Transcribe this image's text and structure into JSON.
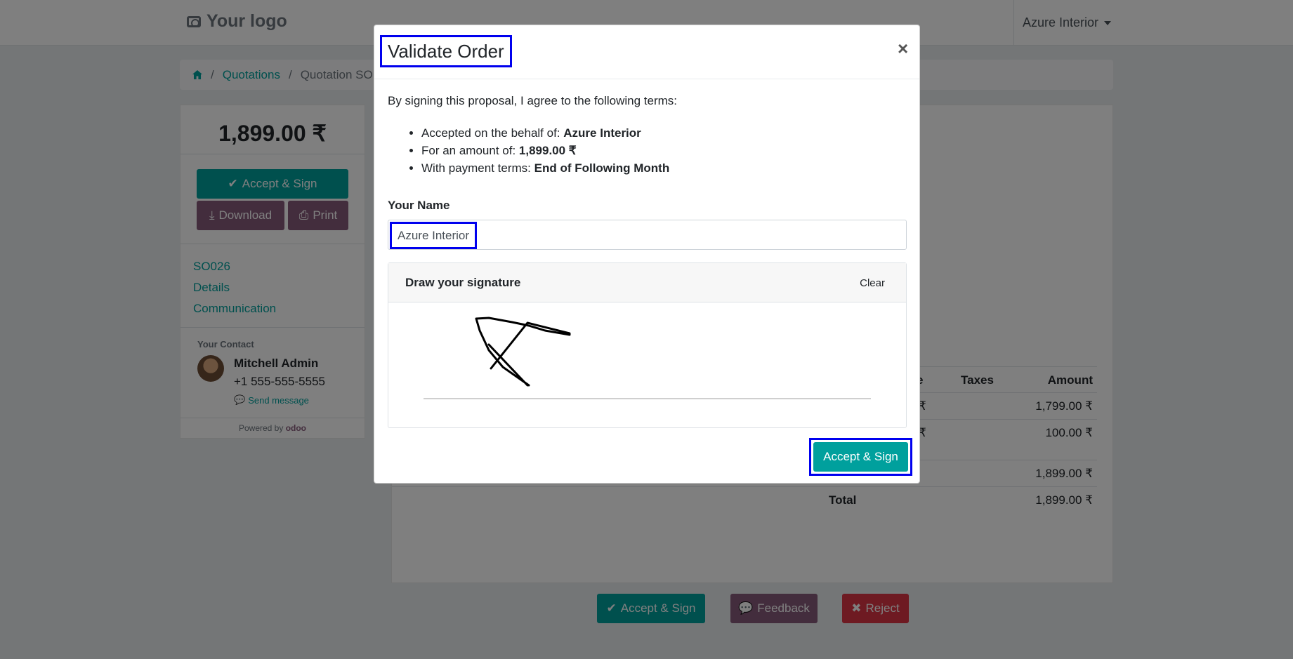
{
  "header": {
    "logo_text": "Your logo",
    "user_menu": "Azure Interior"
  },
  "breadcrumb": {
    "items": [
      "Quotations",
      "Quotation SO"
    ]
  },
  "sidebar": {
    "price": "1,899.00 ₹",
    "accept_sign": "Accept & Sign",
    "download": "Download",
    "print": "Print",
    "links": [
      "SO026",
      "Details",
      "Communication"
    ],
    "contact_heading": "Your Contact",
    "contact_name": "Mitchell Admin",
    "contact_phone": "+1 555-555-5555",
    "send_message": "Send message",
    "powered_by": "Powered by",
    "powered_brand": "odoo"
  },
  "content": {
    "table_headers": [
      "e",
      "Taxes",
      "Amount"
    ],
    "rows": [
      {
        "partial": "₹",
        "amount": "1,799.00 ₹"
      },
      {
        "partial": "₹",
        "amount": "100.00 ₹"
      }
    ],
    "subtotal": "1,899.00 ₹",
    "total_label": "Total",
    "total": "1,899.00 ₹"
  },
  "bottom_actions": {
    "accept": "Accept & Sign",
    "feedback": "Feedback",
    "reject": "Reject"
  },
  "modal": {
    "title": "Validate Order",
    "close": "×",
    "intro": "By signing this proposal, I agree to the following terms:",
    "terms": [
      {
        "label": "Accepted on the behalf of: ",
        "value": "Azure Interior"
      },
      {
        "label": "For an amount of: ",
        "value": "1,899.00 ₹"
      },
      {
        "label": "With payment terms: ",
        "value": "End of Following Month"
      }
    ],
    "name_label": "Your Name",
    "name_value": "Azure Interior",
    "signature_title": "Draw your signature",
    "clear": "Clear",
    "submit": "Accept & Sign"
  },
  "colors": {
    "primary": "#00a09d",
    "secondary": "#875a7b",
    "danger": "#dc3545",
    "highlight": "#0000ee"
  }
}
